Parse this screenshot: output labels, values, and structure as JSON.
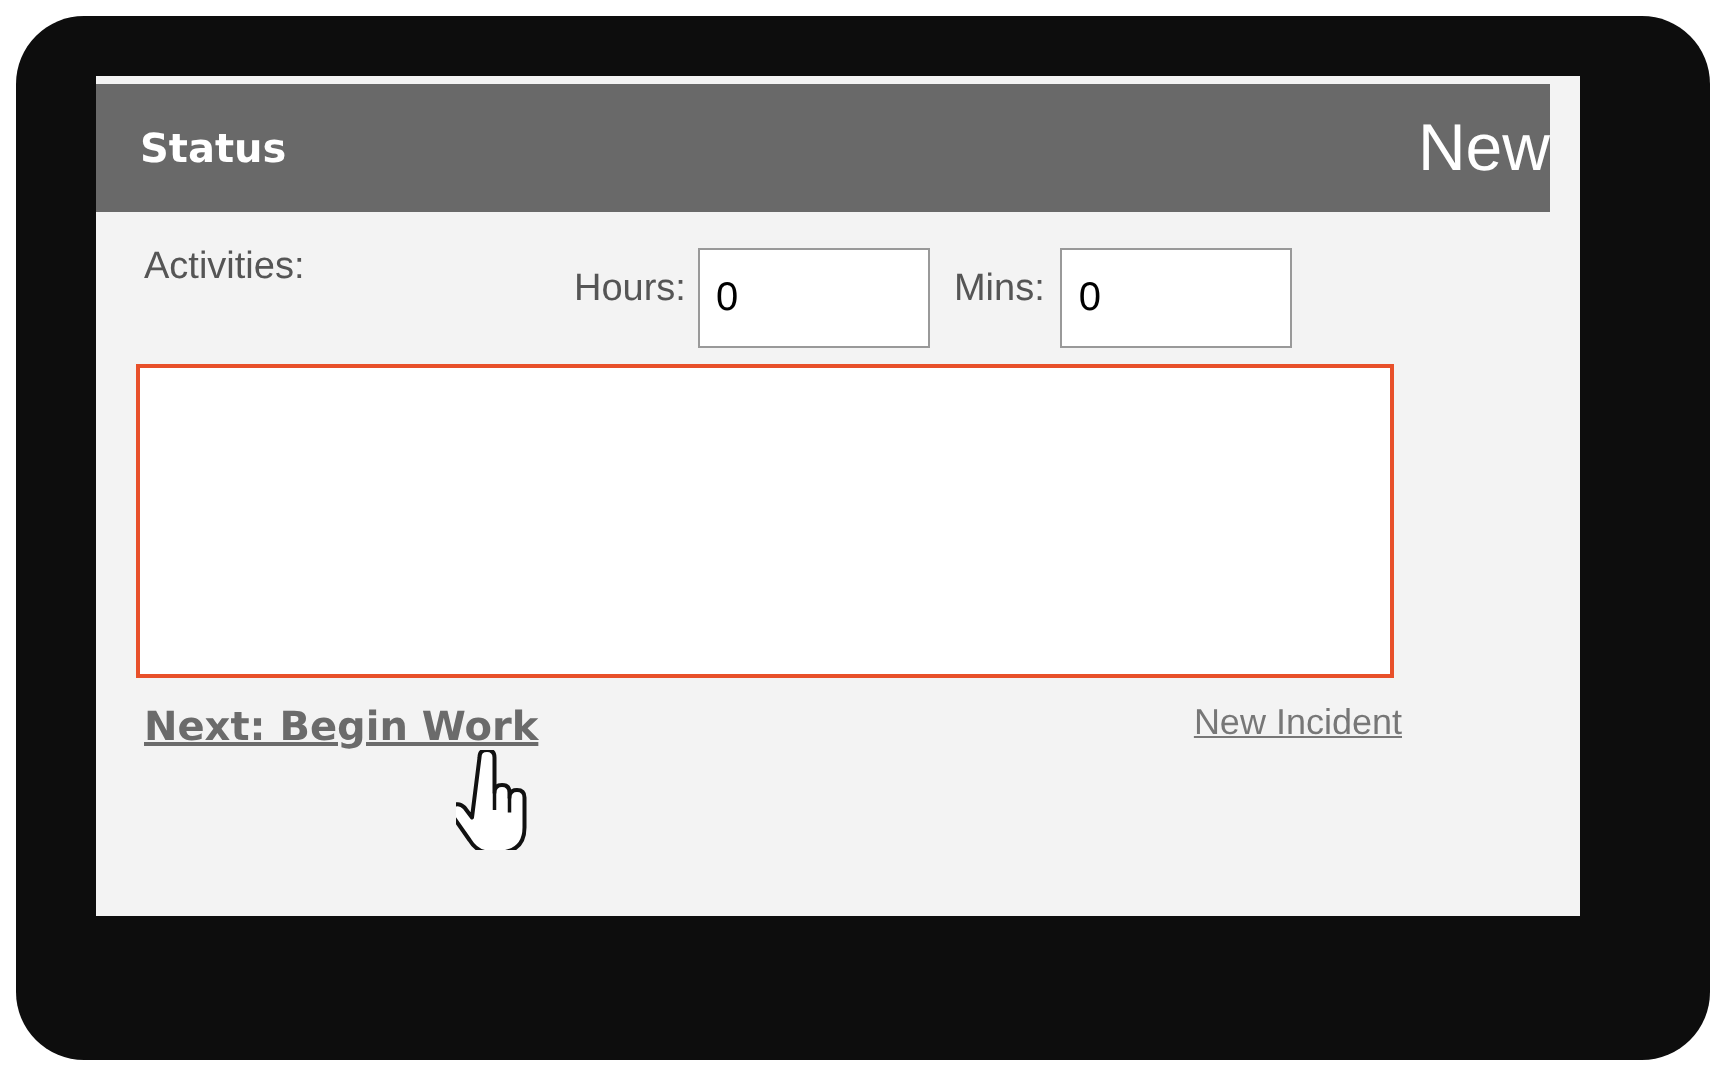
{
  "header": {
    "title": "Status",
    "status": "New"
  },
  "time_fields": {
    "activities_label": "Activities:",
    "hours_label": "Hours:",
    "hours": "0",
    "mins_label": "Mins:",
    "mins": "0"
  },
  "activities_box": {
    "highlighted": true
  },
  "links": [
    {
      "label": "Next: Begin Work",
      "kind": "primary"
    },
    {
      "label": "New Incident",
      "kind": "secondary"
    }
  ]
}
